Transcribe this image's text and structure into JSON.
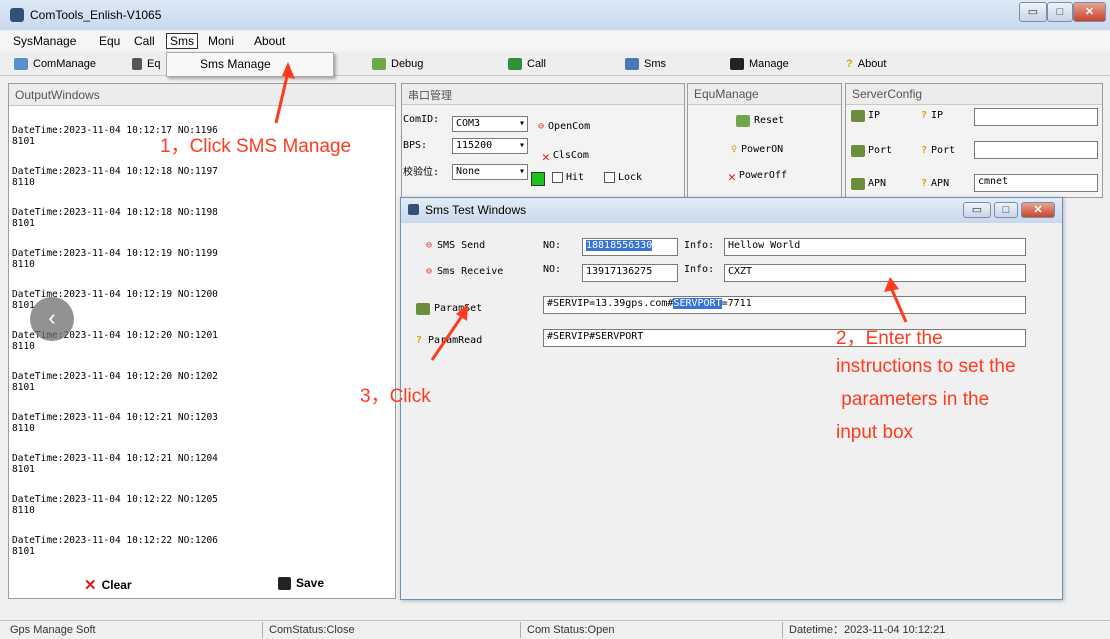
{
  "window": {
    "title": "ComTools_Enlish-V1065",
    "controls": [
      "▭",
      "□",
      "✕"
    ]
  },
  "menubar": [
    "SysManage",
    "Equ",
    "Call",
    "Sms",
    "Moni",
    "About"
  ],
  "toolbar": [
    {
      "label": "ComManage",
      "icon": "com-icon"
    },
    {
      "label": "Eq",
      "icon": "equ-icon"
    },
    {
      "label": "Debug",
      "icon": "debug-icon"
    },
    {
      "label": "Call",
      "icon": "phone-icon"
    },
    {
      "label": "Sms",
      "icon": "sms-icon"
    },
    {
      "label": "Manage",
      "icon": "manage-icon"
    },
    {
      "label": "About",
      "icon": "question-icon"
    }
  ],
  "sms_menu": {
    "item": "Sms Manage"
  },
  "output": {
    "title": "OutputWindows",
    "rows": [
      {
        "line1": "DateTime:2023-11-04 10:12:17  NO:1196",
        "line2": "8101"
      },
      {
        "line1": "DateTime:2023-11-04 10:12:18  NO:1197",
        "line2": "8110"
      },
      {
        "line1": "DateTime:2023-11-04 10:12:18  NO:1198",
        "line2": "8101"
      },
      {
        "line1": "DateTime:2023-11-04 10:12:19  NO:1199",
        "line2": "8110"
      },
      {
        "line1": "DateTime:2023-11-04 10:12:19  NO:1200",
        "line2": "8101"
      },
      {
        "line1": "DateTime:2023-11-04 10:12:20  NO:1201",
        "line2": "8110"
      },
      {
        "line1": "DateTime:2023-11-04 10:12:20  NO:1202",
        "line2": "8101"
      },
      {
        "line1": "DateTime:2023-11-04 10:12:21  NO:1203",
        "line2": "8110"
      },
      {
        "line1": "DateTime:2023-11-04 10:12:21  NO:1204",
        "line2": "8101"
      },
      {
        "line1": "DateTime:2023-11-04 10:12:22  NO:1205",
        "line2": "8110"
      },
      {
        "line1": "DateTime:2023-11-04 10:12:22  NO:1206",
        "line2": "8101"
      }
    ],
    "clear": "Clear",
    "save": "Save"
  },
  "serial": {
    "title": "串口管理",
    "comid_label": "ComID:",
    "comid": "COM3",
    "bps_label": "BPS:",
    "bps": "115200",
    "parity_label": "校验位:",
    "parity": "None",
    "open": "OpenCom",
    "close": "ClsCom",
    "hit": "Hit",
    "lock": "Lock"
  },
  "equ": {
    "title": "EquManage",
    "reset": "Reset",
    "poweron": "PowerON",
    "poweroff": "PowerOff"
  },
  "server": {
    "title": "ServerConfig",
    "ip_btn": "IP",
    "ip_label": "IP",
    "ip": "",
    "port_btn": "Port",
    "port_label": "Port",
    "port": "",
    "apn_btn": "APN",
    "apn_label": "APN",
    "apn": "cmnet"
  },
  "sms": {
    "title": "Sms Test Windows",
    "send": "SMS Send",
    "receive": "Sms Receive",
    "no_label": "NO:",
    "info_label": "Info:",
    "send_no": "18818556330",
    "send_info": "Hellow World",
    "recv_no": "13917136275",
    "recv_info": "CXZT",
    "paramset": "ParamSet",
    "paramread": "ParamRead",
    "set_pre": "#SERVIP=13.39gps.com#",
    "set_hl": "SERVPORT",
    "set_post": "=7711",
    "read_cmd": "#SERVIP#SERVPORT"
  },
  "annotations": {
    "a1": "1，Click SMS Manage",
    "a2_1": "2，Enter the",
    "a2_2": "instructions to set the",
    "a2_3": " parameters in the",
    "a2_4": "input box",
    "a3": "3，Click"
  },
  "status": {
    "s1": "Gps Manage Soft",
    "s2": "ComStatus:Close",
    "s3": "Com Status:Open",
    "s4": "Datetime：2023-11-04 10:12:21"
  },
  "colors": {
    "annotation": "#ff3b1f",
    "selection": "#3874d8",
    "green_indicator": "#1ec21e"
  }
}
